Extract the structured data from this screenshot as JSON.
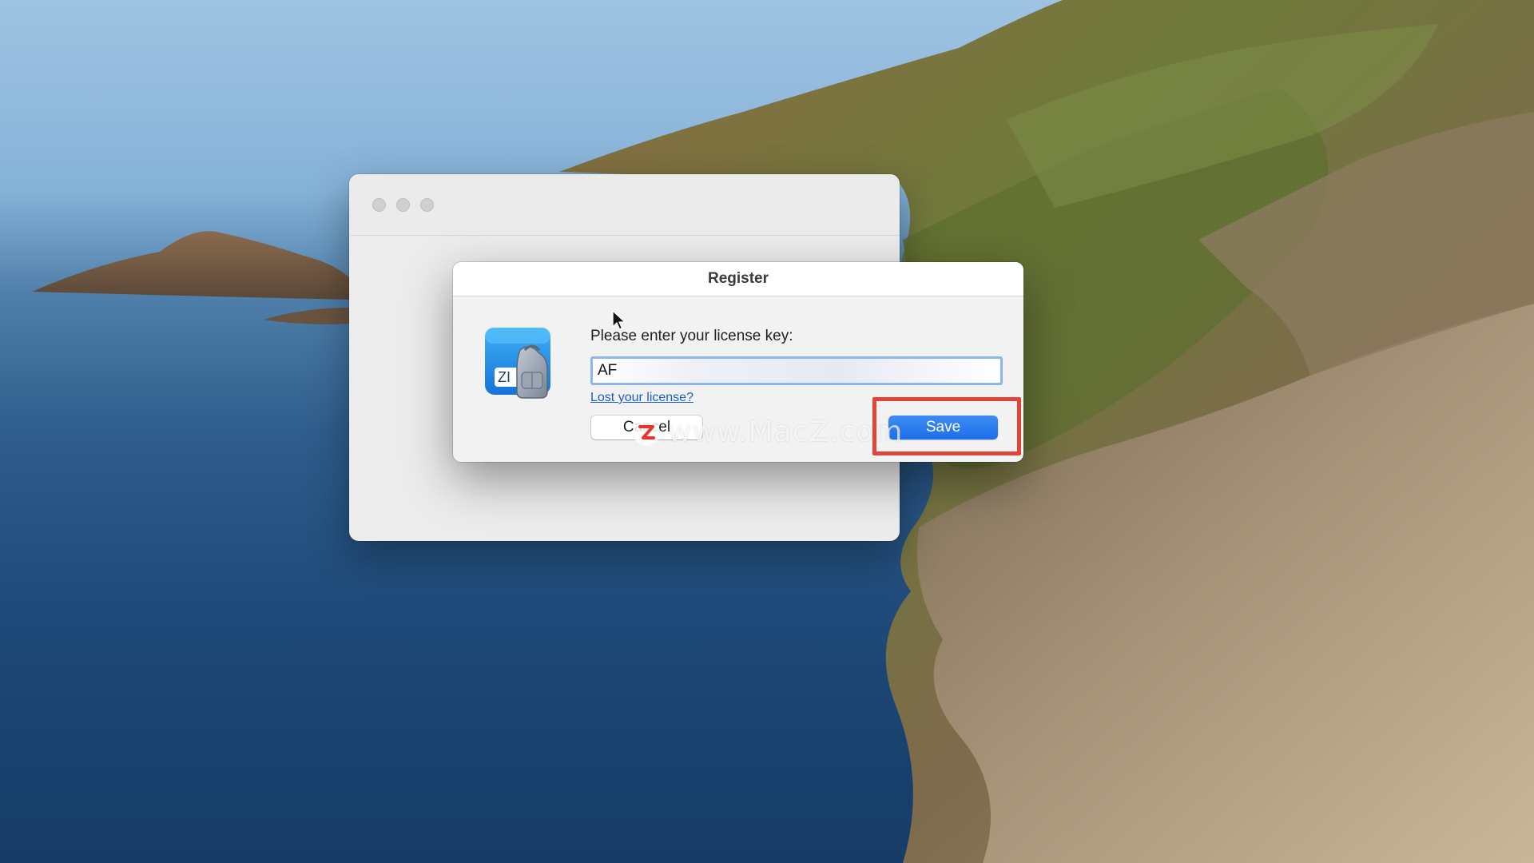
{
  "register_dialog": {
    "title": "Register",
    "prompt": "Please enter your license key:",
    "license_key_value": "AF",
    "lost_license_link": "Lost your license?",
    "cancel_label": "Cancel",
    "save_label": "Save",
    "app_icon_badge": "ZI"
  },
  "watermark": {
    "text": "www.MacZ.com"
  },
  "colors": {
    "accent_blue": "#1f6fe8",
    "highlight_red": "#e2453c",
    "link_blue": "#1a5fc2"
  },
  "icons": {
    "app_icon": "backpack-zip-app-icon",
    "cursor": "arrow-pointer-icon",
    "watermark_logo": "z-logo-icon"
  }
}
